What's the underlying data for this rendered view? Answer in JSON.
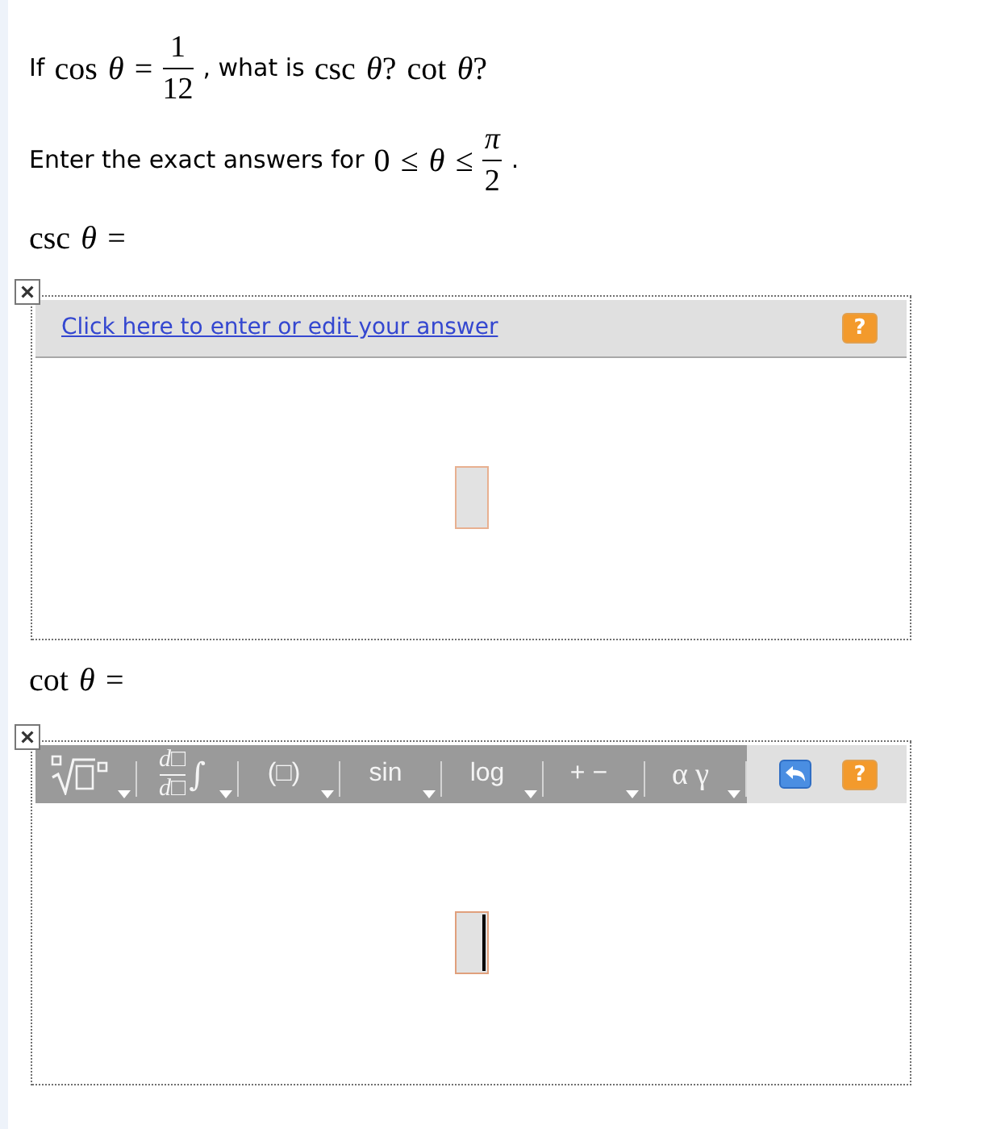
{
  "question": {
    "segments": [
      {
        "kind": "text",
        "text": "If"
      },
      {
        "kind": "math",
        "text": "cos *θ* ="
      },
      {
        "kind": "fraction",
        "numerator": "1",
        "denominator": "12"
      },
      {
        "kind": "text",
        "text": ", what is"
      },
      {
        "kind": "math",
        "text": "csc *θ*? cot *θ*?"
      }
    ]
  },
  "instruction": {
    "segments": [
      {
        "kind": "text",
        "text": "Enter the exact answers for"
      },
      {
        "kind": "math",
        "text": "0 ≤ *θ* ≤"
      },
      {
        "kind": "fraction",
        "numerator": "*π*",
        "denominator": "2"
      },
      {
        "kind": "text",
        "text": "."
      }
    ]
  },
  "answers": [
    {
      "label": "csc *θ* =",
      "editor": {
        "kind": "collapsed",
        "link": "Click here to enter or edit your answer",
        "help_label": "?",
        "cursor_visible": false
      }
    },
    {
      "label": "cot *θ* =",
      "editor": {
        "kind": "toolbar",
        "toolbar": [
          {
            "kind": "radical"
          },
          {
            "kind": "derivative",
            "numerator": "*d*□",
            "denominator": "*d*□",
            "symbol": "∫"
          },
          {
            "kind": "label",
            "label": "(□)"
          },
          {
            "kind": "label",
            "label": "sin"
          },
          {
            "kind": "label",
            "label": "log"
          },
          {
            "kind": "label",
            "label": "+ −"
          },
          {
            "kind": "greek",
            "label": "α γ"
          }
        ],
        "help_label": "?",
        "cursor_visible": true
      }
    }
  ]
}
